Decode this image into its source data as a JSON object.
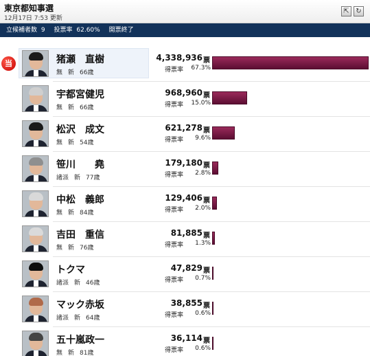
{
  "header": {
    "title": "東京都知事選",
    "updated": "12月17日 7:53 更新"
  },
  "status": {
    "candidates_label": "立候補者数",
    "candidates_value": "9",
    "turnout_label": "投票率",
    "turnout_value": "62.60%",
    "count_state": "開票終了"
  },
  "labels": {
    "votes_unit": "票",
    "rate_label": "得票率",
    "winner_badge": "当"
  },
  "candidates": [
    {
      "name": "猪瀬　直樹",
      "party": "無",
      "status": "新",
      "age": "66歳",
      "votes": "4,338,936",
      "rate": "67.3%",
      "share": 0.673,
      "winner": true,
      "hair": "#1a1a1a"
    },
    {
      "name": "宇都宮健児",
      "party": "無",
      "status": "新",
      "age": "66歳",
      "votes": "968,960",
      "rate": "15.0%",
      "share": 0.15,
      "winner": false,
      "hair": "#cfcfcf"
    },
    {
      "name": "松沢　成文",
      "party": "無",
      "status": "新",
      "age": "54歳",
      "votes": "621,278",
      "rate": "9.6%",
      "share": 0.096,
      "winner": false,
      "hair": "#1a1a1a"
    },
    {
      "name": "笹川　　堯",
      "party": "諸派",
      "status": "新",
      "age": "77歳",
      "votes": "179,180",
      "rate": "2.8%",
      "share": 0.028,
      "winner": false,
      "hair": "#8f8f8f"
    },
    {
      "name": "中松　義郎",
      "party": "無",
      "status": "新",
      "age": "84歳",
      "votes": "129,406",
      "rate": "2.0%",
      "share": 0.02,
      "winner": false,
      "hair": "#d9d9d9"
    },
    {
      "name": "吉田　重信",
      "party": "無",
      "status": "新",
      "age": "76歳",
      "votes": "81,885",
      "rate": "1.3%",
      "share": 0.013,
      "winner": false,
      "hair": "#dadada"
    },
    {
      "name": "トクマ",
      "party": "諸派",
      "status": "新",
      "age": "46歳",
      "votes": "47,829",
      "rate": "0.7%",
      "share": 0.007,
      "winner": false,
      "hair": "#0d0d0d"
    },
    {
      "name": "マック赤坂",
      "party": "諸派",
      "status": "新",
      "age": "64歳",
      "votes": "38,855",
      "rate": "0.6%",
      "share": 0.006,
      "winner": false,
      "hair": "#b06a4a"
    },
    {
      "name": "五十嵐政一",
      "party": "無",
      "status": "新",
      "age": "81歳",
      "votes": "36,114",
      "rate": "0.6%",
      "share": 0.006,
      "winner": false,
      "hair": "#444444"
    }
  ]
}
